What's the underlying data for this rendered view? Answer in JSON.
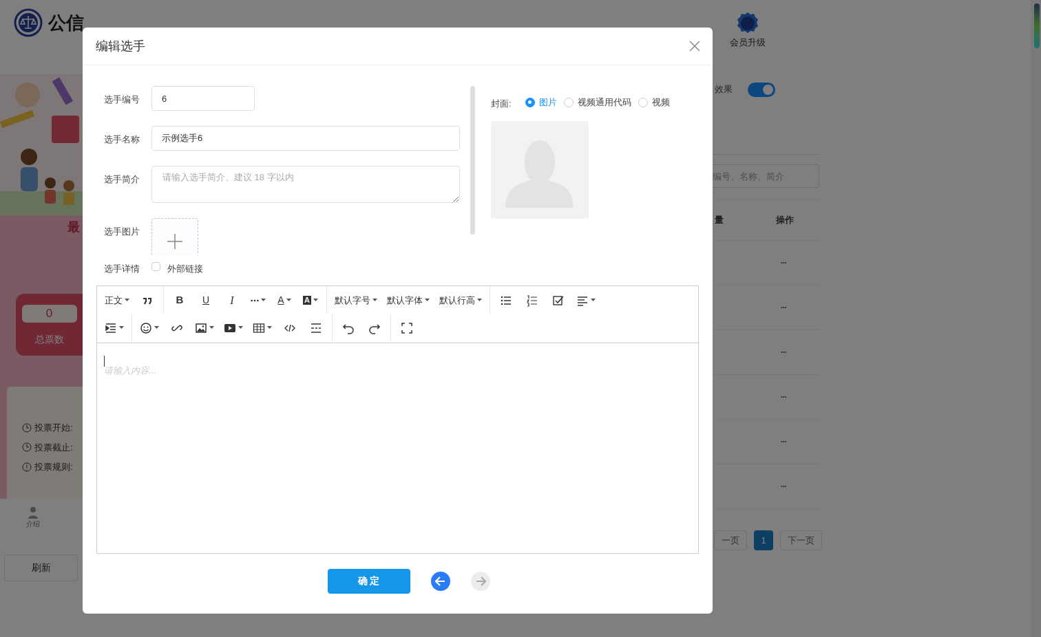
{
  "page": {
    "logo_text": "公信",
    "vip_label": "会员升级",
    "banner_heading": "最",
    "total_votes": {
      "value": "0",
      "label": "总票数"
    },
    "info_lines": [
      "投票开始:",
      "投票截止:",
      "投票规则:"
    ],
    "intro_tab": "介绍",
    "refresh_button": "刷新",
    "effect_toggle": {
      "label": "效果",
      "on": true
    },
    "search": {
      "placeholder": "编号、名称、简介"
    },
    "table": {
      "columns": [
        "量",
        "操作"
      ],
      "row_actions": [
        "•••",
        "•••",
        "•••",
        "•••",
        "•••",
        "•••"
      ]
    },
    "pagination": [
      {
        "label": "一页",
        "selected": false
      },
      {
        "label": "1",
        "selected": true
      },
      {
        "label": "下一页",
        "selected": false
      }
    ]
  },
  "dialog": {
    "title": "编辑选手",
    "fields": [
      {
        "kind": "input",
        "label": "选手编号",
        "value": "6"
      },
      {
        "kind": "input-wide",
        "label": "选手名称",
        "value": "示例选手6"
      },
      {
        "kind": "textarea",
        "label": "选手简介",
        "placeholder": "请输入选手简介、建议 18 字以内"
      },
      {
        "kind": "upload",
        "label": "选手图片"
      },
      {
        "kind": "checkbox",
        "label": "选手详情",
        "option": "外部链接",
        "checked": false
      }
    ],
    "cover": {
      "label": "封面:",
      "options": [
        {
          "label": "图片",
          "selected": true
        },
        {
          "label": "视频通用代码",
          "selected": false
        },
        {
          "label": "视频",
          "selected": false
        }
      ]
    },
    "toolbar": [
      [
        [
          {
            "kind": "text",
            "label": "正文",
            "dropdown": true
          },
          {
            "kind": "icon",
            "dropdown": false
          }
        ],
        [
          {
            "kind": "bold",
            "label": "B",
            "dropdown": false
          },
          {
            "kind": "underline",
            "label": "U",
            "dropdown": false
          },
          {
            "kind": "italic",
            "label": "I",
            "dropdown": false
          },
          {
            "kind": "icon",
            "dropdown": true
          },
          {
            "kind": "underline",
            "label": "A",
            "dropdown": true
          },
          {
            "kind": "boxed",
            "label": "A",
            "dropdown": true
          }
        ],
        [
          {
            "kind": "text",
            "label": "默认字号",
            "dropdown": true
          },
          {
            "kind": "text",
            "label": "默认字体",
            "dropdown": true
          },
          {
            "kind": "text",
            "label": "默认行高",
            "dropdown": true
          }
        ],
        [
          {
            "kind": "icon",
            "dropdown": false
          },
          {
            "kind": "icon",
            "dropdown": false
          },
          {
            "kind": "icon",
            "dropdown": false
          },
          {
            "kind": "icon",
            "dropdown": true
          }
        ]
      ],
      [
        [
          {
            "kind": "icon",
            "dropdown": true
          }
        ],
        [
          {
            "kind": "icon",
            "dropdown": true
          },
          {
            "kind": "icon",
            "dropdown": false
          },
          {
            "kind": "icon",
            "dropdown": true
          },
          {
            "kind": "icon",
            "dropdown": true
          },
          {
            "kind": "icon",
            "dropdown": true
          },
          {
            "kind": "icon",
            "dropdown": false
          },
          {
            "kind": "icon",
            "dropdown": false
          }
        ],
        [
          {
            "kind": "icon",
            "dropdown": false
          },
          {
            "kind": "icon",
            "dropdown": false
          }
        ],
        [
          {
            "kind": "icon",
            "dropdown": false
          }
        ]
      ]
    ],
    "editor_placeholder": "请输入内容...",
    "confirm_button": "确 定",
    "nav": [
      {
        "kind": "prev",
        "disabled": false
      },
      {
        "kind": "next",
        "disabled": true
      }
    ]
  }
}
